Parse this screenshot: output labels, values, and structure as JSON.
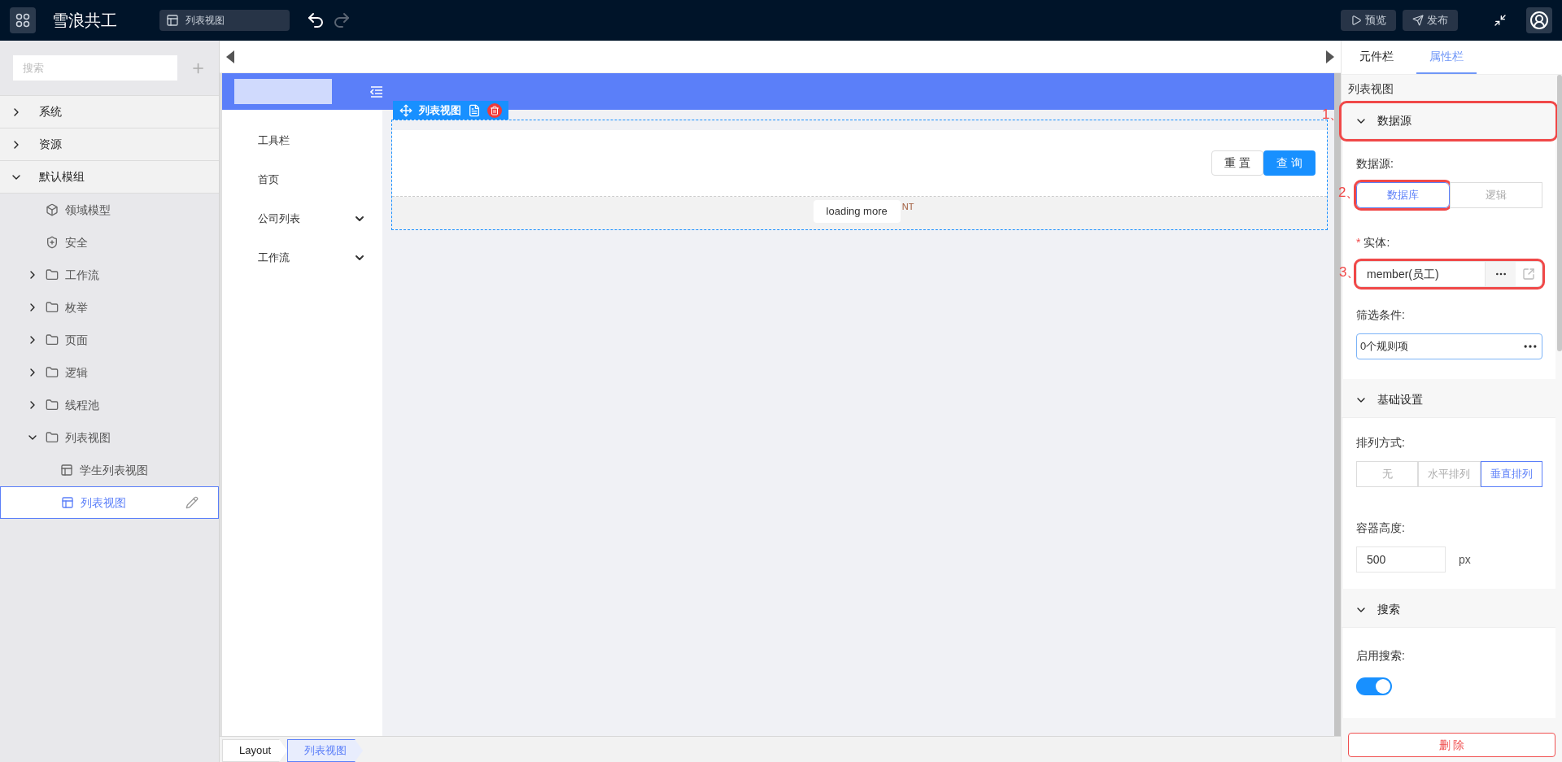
{
  "topbar": {
    "app_title": "雪浪共工",
    "open_tab": "列表视图",
    "buttons": [
      {
        "label": "预览",
        "kind": "preview"
      },
      {
        "label": "发布",
        "kind": "publish"
      }
    ]
  },
  "explorer": {
    "search": {
      "placeholder": "搜索"
    },
    "tree": [
      {
        "label": "系统",
        "expanded": false,
        "selected": false
      },
      {
        "label": "资源",
        "expanded": false,
        "selected": false
      },
      {
        "label": "默认模组",
        "expanded": true,
        "selected": false,
        "children": [
          {
            "label": "领域模型",
            "kind": "cube",
            "selected": false
          },
          {
            "label": "安全",
            "kind": "shield",
            "selected": false
          },
          {
            "label": "工作流",
            "kind": "folder",
            "expanded": false,
            "selected": false
          },
          {
            "label": "枚举",
            "kind": "folder",
            "expanded": false,
            "selected": false
          },
          {
            "label": "页面",
            "kind": "folder",
            "expanded": false,
            "selected": false
          },
          {
            "label": "逻辑",
            "kind": "folder",
            "expanded": false,
            "selected": false
          },
          {
            "label": "线程池",
            "kind": "folder",
            "expanded": false,
            "selected": false
          },
          {
            "label": "列表视图",
            "kind": "folder",
            "expanded": true,
            "selected": false,
            "children": [
              {
                "label": "学生列表视图",
                "kind": "view",
                "selected": false
              },
              {
                "label": "列表视图",
                "kind": "view",
                "selected": true
              }
            ]
          }
        ]
      }
    ]
  },
  "canvas": {
    "preview_nav": [
      {
        "label": "工具栏",
        "expandable": false
      },
      {
        "label": "首页",
        "expandable": false
      },
      {
        "label": "公司列表",
        "expandable": true
      },
      {
        "label": "工作流",
        "expandable": true
      }
    ],
    "selected_component": "列表视图",
    "search_buttons": [
      {
        "label": "重 置",
        "primary": false
      },
      {
        "label": "查 询",
        "primary": true
      }
    ],
    "loading_label": "loading more",
    "covered_text": "NT"
  },
  "breadcrumb": [
    {
      "label": "Layout",
      "selected": false
    },
    {
      "label": "列表视图",
      "selected": true
    }
  ],
  "properties": {
    "tabs": [
      {
        "label": "元件栏",
        "selected": false
      },
      {
        "label": "属性栏",
        "selected": true
      }
    ],
    "component_name": "列表视图",
    "sections": [
      {
        "title": "数据源",
        "expanded": true,
        "highlighted": true,
        "annotation": "1、",
        "fields": [
          {
            "kind": "segmented",
            "label": "数据源:",
            "highlighted": true,
            "annotation": "2、",
            "options": [
              {
                "label": "数据库",
                "selected": true
              },
              {
                "label": "逻辑",
                "selected": false
              }
            ]
          },
          {
            "kind": "entity",
            "label": "实体:",
            "required_mark": "*",
            "value": "member(员工)",
            "highlighted": true,
            "annotation": "3、"
          },
          {
            "kind": "rule",
            "label": "筛选条件:",
            "value": "0个规则项"
          }
        ]
      },
      {
        "title": "基础设置",
        "expanded": true,
        "highlighted": false,
        "fields": [
          {
            "kind": "segmented",
            "label": "排列方式:",
            "options": [
              {
                "label": "无",
                "selected": false
              },
              {
                "label": "水平排列",
                "selected": false
              },
              {
                "label": "垂直排列",
                "selected": true
              }
            ]
          },
          {
            "kind": "number",
            "label": "容器高度:",
            "value": "500",
            "unit": "px"
          }
        ]
      },
      {
        "title": "搜索",
        "expanded": true,
        "highlighted": false,
        "fields": [
          {
            "kind": "switch",
            "label": "启用搜索:",
            "on": true
          }
        ]
      }
    ],
    "delete_button": "删 除"
  }
}
